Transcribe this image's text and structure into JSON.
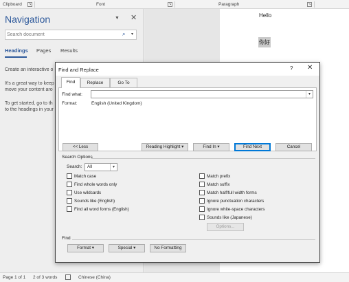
{
  "ribbon": {
    "groups": [
      "Clipboard",
      "Font",
      "Paragraph"
    ]
  },
  "navigation": {
    "title": "Navigation",
    "search_placeholder": "Search document",
    "tabs": [
      "Headings",
      "Pages",
      "Results"
    ],
    "active_tab": "Headings",
    "text_lines": [
      "Create an interactive o",
      "It's a great way to keep",
      "move your content aro",
      "To get started, go to th",
      "to the headings in your"
    ]
  },
  "document": {
    "line1": "Hello",
    "line2": "你好"
  },
  "dialog": {
    "title": "Find and Replace",
    "help": "?",
    "tabs": [
      "Find",
      "Replace",
      "Go To"
    ],
    "active_tab": "Find",
    "find_what_label": "Find what:",
    "find_what_value": "",
    "format_label": "Format:",
    "format_value": "English (United Kingdom)",
    "buttons": {
      "less": "<< Less",
      "reading_highlight": "Reading Highlight ▾",
      "find_in": "Find In ▾",
      "find_next": "Find Next",
      "cancel": "Cancel"
    },
    "search_options_title": "Search Options",
    "search_label": "Search:",
    "search_value": "All",
    "left_options": [
      "Match case",
      "Find whole words only",
      "Use wildcards",
      "Sounds like (English)",
      "Find all word forms (English)"
    ],
    "right_options": [
      "Match prefix",
      "Match suffix",
      "Match half/full width forms",
      "Ignore punctuation characters",
      "Ignore white-space characters",
      "Sounds like (Japanese)"
    ],
    "options_button": "Options...",
    "find_section_title": "Find",
    "format_button": "Format ▾",
    "special_button": "Special ▾",
    "no_formatting_button": "No Formatting"
  },
  "status": {
    "page": "Page 1 of 1",
    "words": "2 of 3 words",
    "language": "Chinese (China)"
  },
  "colors": {
    "accent": "#2b579a",
    "focus": "#0078d7"
  }
}
